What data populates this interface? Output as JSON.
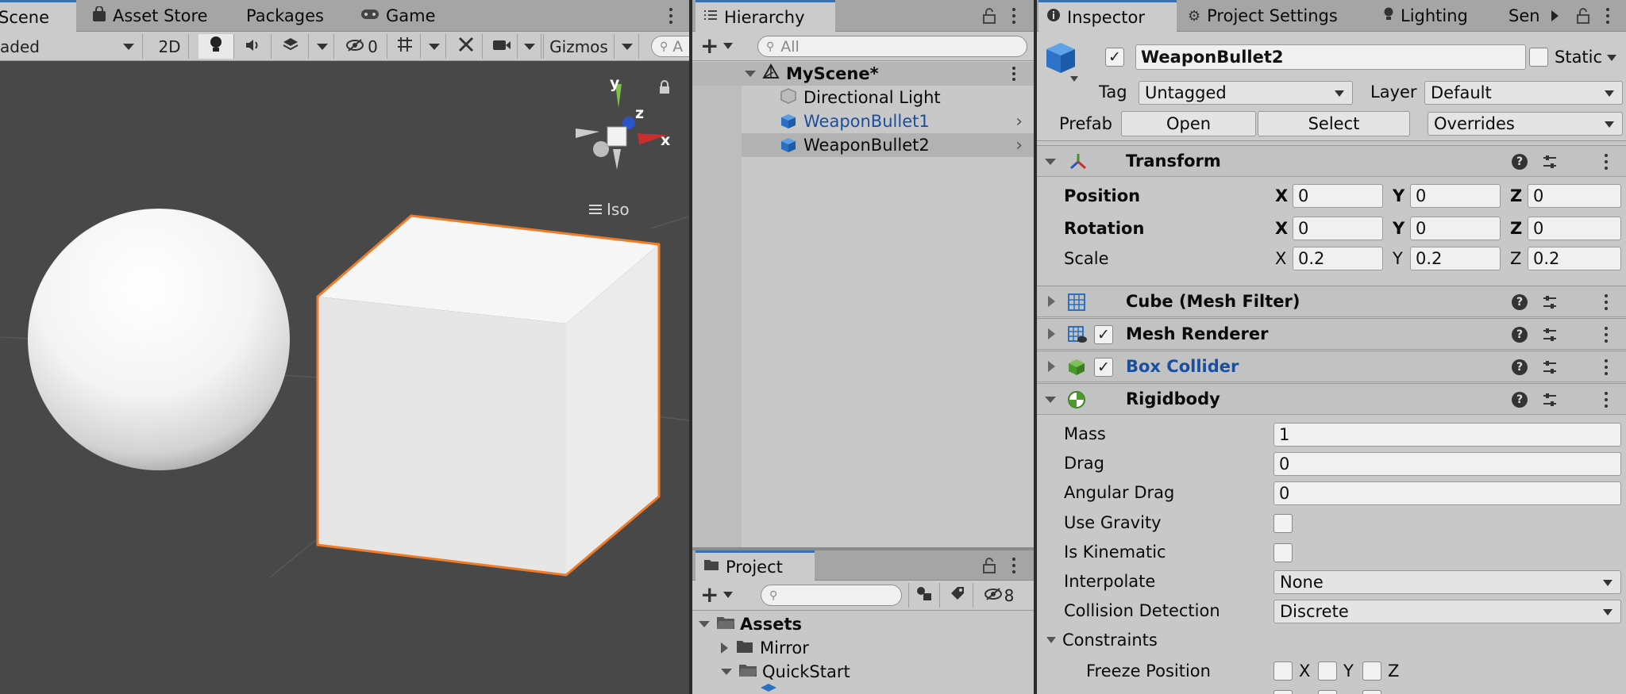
{
  "scene": {
    "tabs": [
      "Scene",
      "Asset Store",
      "Packages",
      "Game"
    ],
    "shading_mode": "aded",
    "btn_2d": "2D",
    "hidden_count": "0",
    "gizmos_label": "Gizmos",
    "search_placeholder": "A",
    "gizmo_axes": {
      "x": "x",
      "y": "y",
      "z": "z"
    },
    "projection_label": "Iso"
  },
  "hierarchy": {
    "tab": "Hierarchy",
    "search_placeholder": "All",
    "scene_name": "MyScene*",
    "items": [
      "Directional Light",
      "WeaponBullet1",
      "WeaponBullet2"
    ]
  },
  "project": {
    "tab": "Project",
    "hidden_count": "8",
    "tree": [
      "Assets",
      "Mirror",
      "QuickStart"
    ]
  },
  "inspector": {
    "tabs": [
      "Inspector",
      "Project Settings",
      "Lighting",
      "Sen"
    ],
    "object_name": "WeaponBullet2",
    "static_label": "Static",
    "tag_label": "Tag",
    "tag_value": "Untagged",
    "layer_label": "Layer",
    "layer_value": "Default",
    "prefab_label": "Prefab",
    "prefab_open": "Open",
    "prefab_select": "Select",
    "prefab_overrides": "Overrides",
    "transform": {
      "title": "Transform",
      "position_label": "Position",
      "rotation_label": "Rotation",
      "scale_label": "Scale",
      "axis_x": "X",
      "axis_y": "Y",
      "axis_z": "Z",
      "position": {
        "x": "0",
        "y": "0",
        "z": "0"
      },
      "rotation": {
        "x": "0",
        "y": "0",
        "z": "0"
      },
      "scale": {
        "x": "0.2",
        "y": "0.2",
        "z": "0.2"
      }
    },
    "components": [
      "Cube (Mesh Filter)",
      "Mesh Renderer",
      "Box Collider"
    ],
    "rigidbody": {
      "title": "Rigidbody",
      "mass_label": "Mass",
      "mass": "1",
      "drag_label": "Drag",
      "drag": "0",
      "angular_drag_label": "Angular Drag",
      "angular_drag": "0",
      "use_gravity_label": "Use Gravity",
      "is_kinematic_label": "Is Kinematic",
      "interpolate_label": "Interpolate",
      "interpolate": "None",
      "collision_label": "Collision Detection",
      "collision": "Discrete",
      "constraints_label": "Constraints",
      "freeze_position_label": "Freeze Position",
      "axis_x": "X",
      "axis_y": "Y",
      "axis_z": "Z"
    }
  },
  "colors": {
    "accent": "#3a72b0",
    "selection_outline": "#f07b28",
    "link_blue": "#1a4fa0"
  }
}
